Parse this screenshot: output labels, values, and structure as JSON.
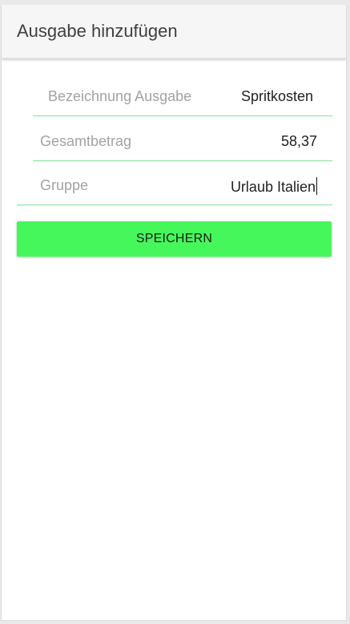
{
  "header": {
    "title": "Ausgabe hinzufügen"
  },
  "form": {
    "fields": [
      {
        "label": "Bezeichnung Ausgabe",
        "value": "Spritkosten"
      },
      {
        "label": "Gesamtbetrag",
        "value": "58,37"
      },
      {
        "label": "Gruppe",
        "value": "Urlaub Italien"
      }
    ],
    "save_label": "SPEICHERN"
  },
  "colors": {
    "accent_button": "#46f75c",
    "field_underline": "#7fe295",
    "header_background": "#f6f6f6"
  }
}
